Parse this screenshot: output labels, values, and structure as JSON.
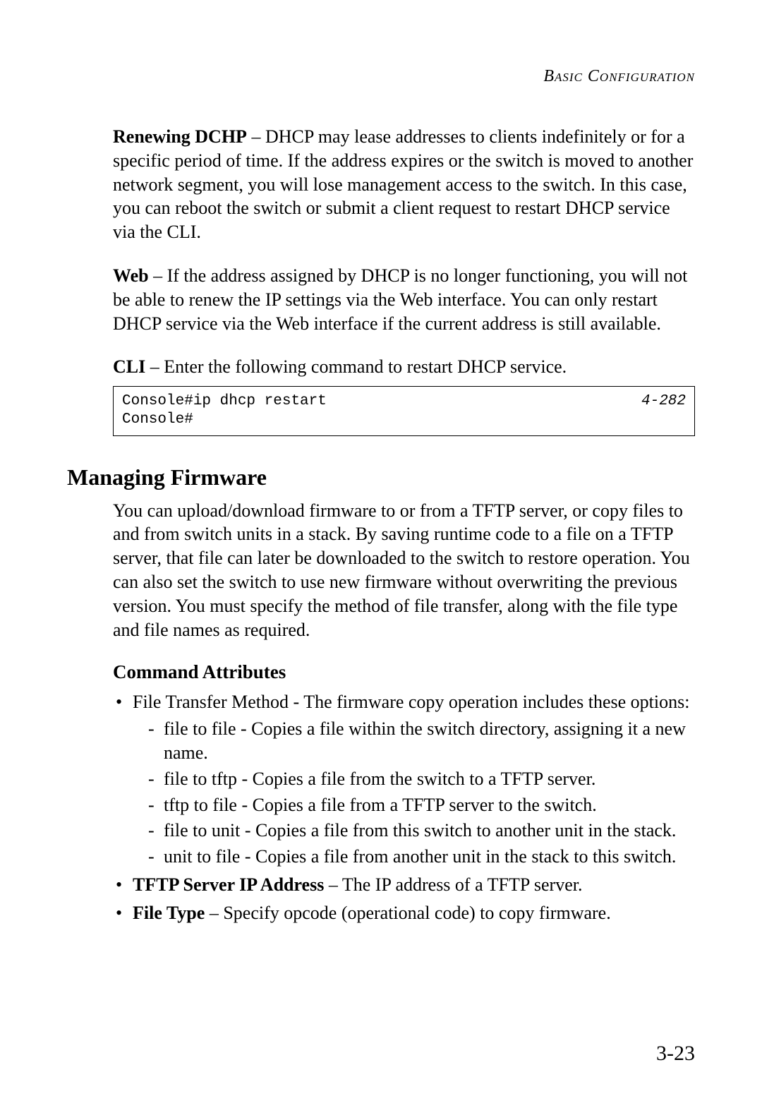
{
  "header": {
    "title": "Basic Configuration"
  },
  "paragraphs": {
    "p1_lead": "Renewing DCHP",
    "p1_body": " – DHCP may lease addresses to clients indefinitely or for a specific period of time. If the address expires or the switch is moved to another network segment, you will lose management access to the switch. In this case, you can reboot the switch or submit a client request to restart DHCP service via the CLI.",
    "p2_lead": "Web",
    "p2_body": " – If the address assigned by DHCP is no longer functioning, you will not be able to renew the IP settings via the Web interface. You can only restart DHCP service via the Web interface if the current address is still available.",
    "p3_lead": "CLI",
    "p3_body": " – Enter the following command to restart DHCP service."
  },
  "code": {
    "line1": "Console#ip dhcp restart",
    "line2": "Console#",
    "ref": "4-282"
  },
  "section": {
    "heading": "Managing Firmware",
    "intro": "You can upload/download firmware to or from a TFTP server, or copy files to and from switch units in a stack. By saving runtime code to a file on a TFTP server, that file can later be downloaded to the switch to restore operation. You can also set the switch to use new firmware without overwriting the previous version. You must specify the method of file transfer, along with the file type and file names as required.",
    "subheading": "Command Attributes"
  },
  "bullets": {
    "b1_text": " File Transfer Method - The firmware copy operation includes these options:",
    "b1_subs": [
      "file to file - Copies a file within the switch directory, assigning it a new name.",
      "file to tftp - Copies a file from the switch to a TFTP server.",
      "tftp to file - Copies a file from a TFTP server to the switch.",
      "file to unit - Copies a file from this switch to another unit in the stack.",
      "unit to file - Copies a file from another unit in the stack to this switch."
    ],
    "b2_lead": "TFTP Server IP Address",
    "b2_body": " – The IP address of a TFTP server.",
    "b3_lead": "File Type",
    "b3_body": " – Specify opcode (operational code) to copy firmware."
  },
  "page_number": "3-23"
}
